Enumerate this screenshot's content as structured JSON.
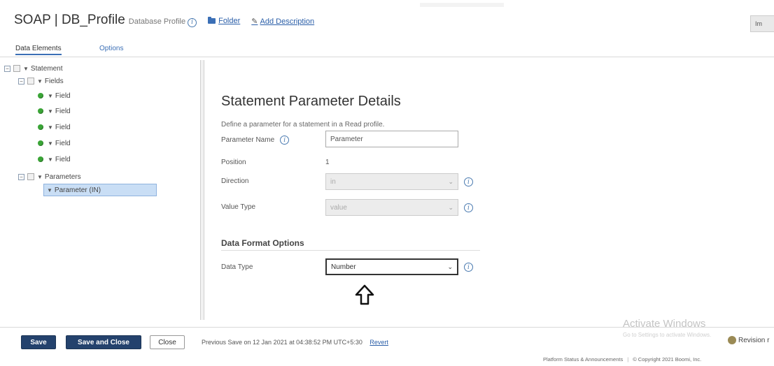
{
  "header": {
    "title": "SOAP | DB_Profile",
    "subtitle": "Database Profile",
    "info_glyph": "i",
    "folder_link": "Folder",
    "add_description_link": "Add Description",
    "top_right_button": "Im"
  },
  "tabs": [
    {
      "label": "Data Elements",
      "active": true
    },
    {
      "label": "Options",
      "active": false
    }
  ],
  "tree": {
    "statement": "Statement",
    "fields_group": "Fields",
    "fields": [
      "Field",
      "Field",
      "Field",
      "Field",
      "Field"
    ],
    "parameters_group": "Parameters",
    "selected_parameter": "Parameter (IN)",
    "expander_glyph": "−",
    "caret_glyph": "▼"
  },
  "details": {
    "title": "Statement Parameter Details",
    "description": "Define a parameter for a statement in a Read profile.",
    "parameter_name_label": "Parameter Name",
    "parameter_name_value": "Parameter",
    "position_label": "Position",
    "position_value": "1",
    "direction_label": "Direction",
    "direction_value": "in",
    "value_type_label": "Value Type",
    "value_type_value": "value",
    "section_heading": "Data Format Options",
    "data_type_label": "Data Type",
    "data_type_value": "Number",
    "select_arrow_glyph": "⌄"
  },
  "footer": {
    "save": "Save",
    "save_and_close": "Save and Close",
    "close": "Close",
    "previous_save": "Previous Save on 12 Jan 2021 at 04:38:52 PM UTC+5:30",
    "revert": "Revert",
    "revision": "Revision r",
    "watermark_title": "Activate Windows",
    "watermark_sub": "Go to Settings to activate Windows."
  },
  "bottom": {
    "status_link": "Platform Status & Announcements",
    "copyright": "© Copyright 2021 Boomi, Inc."
  },
  "colors": {
    "primary_button": "#24426d",
    "link": "#2a5ea8",
    "leaf_dot": "#3aa536",
    "selection": "#c9def5"
  }
}
